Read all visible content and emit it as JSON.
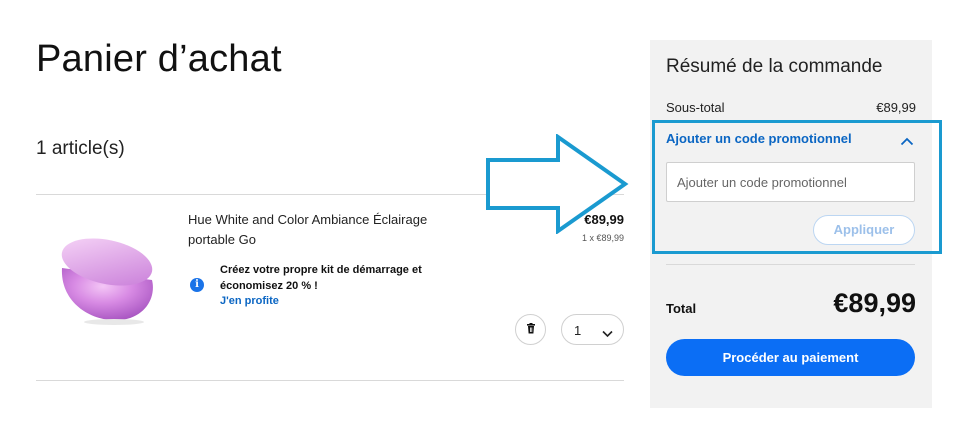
{
  "cart": {
    "title": "Panier d’achat",
    "item_count": "1 article(s)"
  },
  "item": {
    "name": "Hue White and Color Ambiance Éclairage portable Go",
    "price": "€89,99",
    "unit_price": "1 x €89,99",
    "promo_message": "Créez votre propre kit de démarrage et économisez 20 % !",
    "promo_link": "J'en profite",
    "quantity": "1",
    "image_icon": "lamp-product-image"
  },
  "summary": {
    "title": "Résumé de la commande",
    "subtotal_label": "Sous-total",
    "subtotal_value": "€89,99",
    "promo_header": "Ajouter un code promotionnel",
    "promo_placeholder": "Ajouter un code promotionnel",
    "apply_label": "Appliquer",
    "total_label": "Total",
    "total_value": "€89,99",
    "checkout_label": "Procéder au paiement"
  },
  "colors": {
    "accent_blue": "#0b6ef5",
    "link_blue": "#0b66c3",
    "annotation_blue": "#1a9ad0",
    "panel_bg": "#f2f2f2"
  }
}
